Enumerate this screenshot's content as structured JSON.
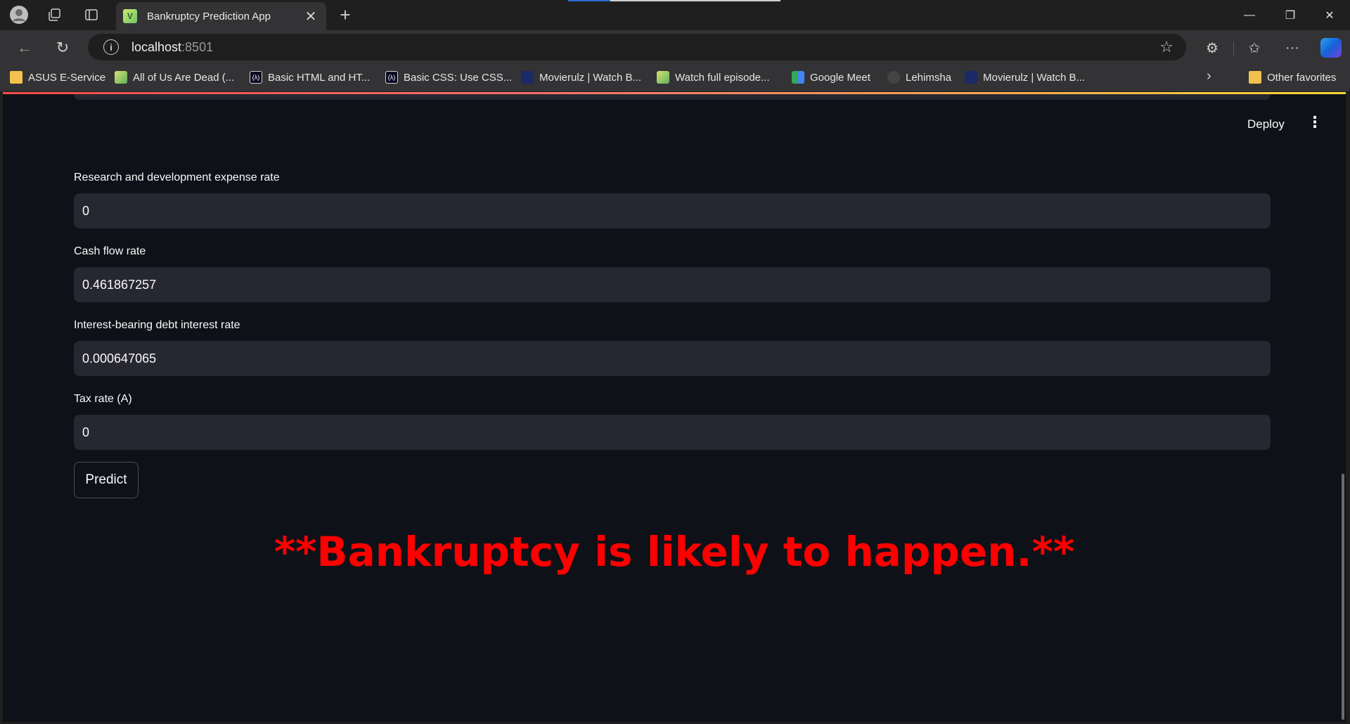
{
  "browser": {
    "tab_title": "Bankruptcy Prediction App",
    "tab_favicon_text": "V",
    "url_host": "localhost",
    "url_port": ":8501",
    "favorites": [
      {
        "label": "ASUS E-Service",
        "icon": "folder-icon"
      },
      {
        "label": "All of Us Are Dead (...",
        "icon": "image-favicon"
      },
      {
        "label": "Basic HTML and HT...",
        "icon": "freecodecamp-icon"
      },
      {
        "label": "Basic CSS: Use CSS...",
        "icon": "freecodecamp-icon"
      },
      {
        "label": "Movierulz | Watch B...",
        "icon": "movie-favicon"
      },
      {
        "label": "Watch full episode...",
        "icon": "image-favicon"
      },
      {
        "label": "Google Meet",
        "icon": "google-meet-icon"
      },
      {
        "label": "Lehimsha",
        "icon": "github-icon"
      },
      {
        "label": "Movierulz | Watch B...",
        "icon": "movie-favicon"
      }
    ],
    "other_favorites": "Other favorites"
  },
  "app": {
    "deploy_label": "Deploy",
    "fields": [
      {
        "label": "Research and development expense rate",
        "value": "0"
      },
      {
        "label": "Cash flow rate",
        "value": "0.461867257"
      },
      {
        "label": "Interest-bearing debt interest rate",
        "value": "0.000647065"
      },
      {
        "label": "Tax rate (A)",
        "value": "0"
      }
    ],
    "predict_label": "Predict",
    "result_text": "**Bankruptcy is likely to happen.**",
    "result_color": "#ff0000"
  }
}
